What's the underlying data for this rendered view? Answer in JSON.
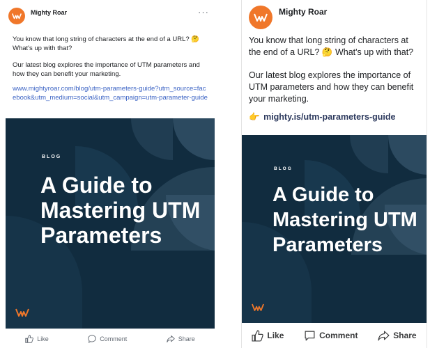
{
  "left_post": {
    "page_name": "Mighty Roar",
    "more_label": "···",
    "paragraph1": "You know that long string of characters at the end of a URL? 🤔 What's up with that?",
    "paragraph2": "Our latest blog explores the importance of UTM parameters and how they can benefit your marketing.",
    "link": "www.mightyroar.com/blog/utm-parameters-guide?utm_source=facebook&utm_medium=social&utm_campaign=utm-parameter-guide",
    "image": {
      "kicker": "BLOG",
      "title": "A Guide to Mastering UTM Parameters"
    },
    "actions": {
      "like": "Like",
      "comment": "Comment",
      "share": "Share"
    }
  },
  "right_post": {
    "page_name": "Mighty Roar",
    "paragraph1": "You know that long string of characters at the end of a URL? 🤔 What's up with that?",
    "paragraph2": "Our latest blog explores the importance of UTM parameters and how they can benefit your marketing.",
    "link_pointer": "👉",
    "link": "mighty.is/utm-parameters-guide",
    "image": {
      "kicker": "BLOG",
      "title": "A Guide to Mastering UTM Parameters"
    },
    "actions": {
      "like": "Like",
      "comment": "Comment",
      "share": "Share"
    }
  },
  "colors": {
    "brand_orange": "#f0772a",
    "image_navy": "#112c3f",
    "link_blue": "#3b63c4"
  },
  "icons": [
    "mighty-roar-logo-icon",
    "like-icon",
    "comment-icon",
    "share-icon",
    "more-options-icon"
  ]
}
